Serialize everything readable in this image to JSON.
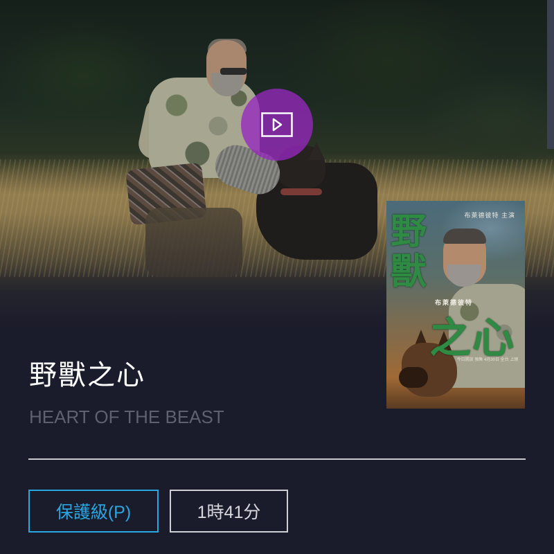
{
  "movie": {
    "title_zh": "野獸之心",
    "title_en": "HEART OF THE BEAST",
    "rating": "保護級(P)",
    "runtime": "1時41分"
  },
  "hero": {
    "play_icon": "play-icon",
    "play_color": "#9628be"
  },
  "poster": {
    "title_top": "野獸",
    "title_bottom": "之心",
    "tagline": "布萊德彼特 主演",
    "actor": "布萊德彼特",
    "credits": "今日開放 預售 4月30日 全台 上映"
  },
  "colors": {
    "background": "#1a1b2b",
    "accent": "#2aa6e0"
  }
}
